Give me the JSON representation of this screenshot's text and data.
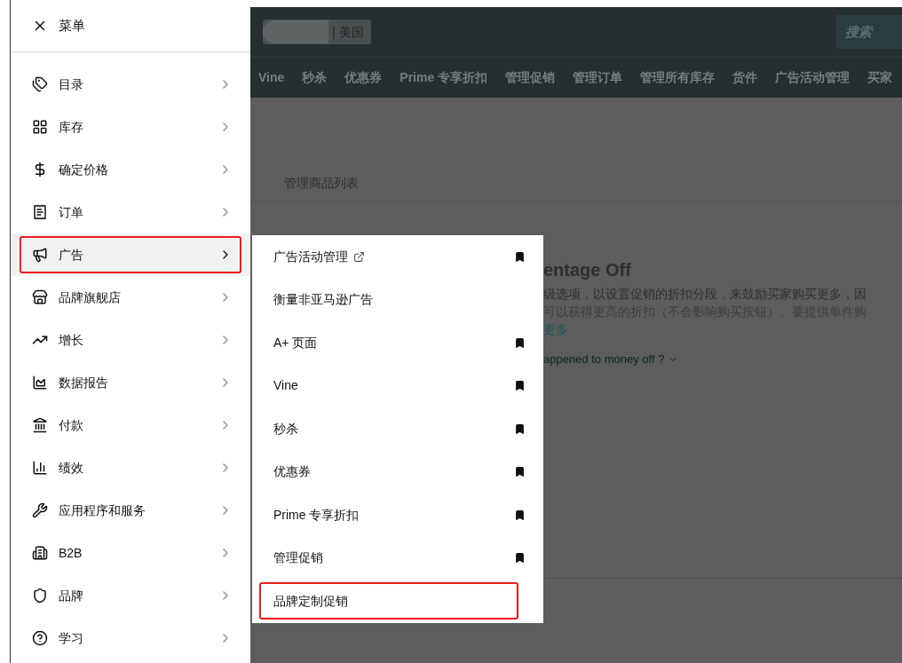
{
  "menu": {
    "title": "菜单",
    "items": [
      {
        "label": "目录",
        "selected": false,
        "outlined": false
      },
      {
        "label": "库存",
        "selected": false,
        "outlined": false
      },
      {
        "label": "确定价格",
        "selected": false,
        "outlined": false
      },
      {
        "label": "订单",
        "selected": false,
        "outlined": false
      },
      {
        "label": "广告",
        "selected": true,
        "outlined": true
      },
      {
        "label": "品牌旗舰店",
        "selected": false,
        "outlined": false
      },
      {
        "label": "增长",
        "selected": false,
        "outlined": false
      },
      {
        "label": "数据报告",
        "selected": false,
        "outlined": false
      },
      {
        "label": "付款",
        "selected": false,
        "outlined": false
      },
      {
        "label": "绩效",
        "selected": false,
        "outlined": false
      },
      {
        "label": "应用程序和服务",
        "selected": false,
        "outlined": false
      },
      {
        "label": "B2B",
        "selected": false,
        "outlined": false
      },
      {
        "label": "品牌",
        "selected": false,
        "outlined": false
      },
      {
        "label": "学习",
        "selected": false,
        "outlined": false
      }
    ]
  },
  "submenu": {
    "items": [
      {
        "label": "广告活动管理",
        "external": true,
        "bookmarked": true,
        "outlined": false
      },
      {
        "label": "衡量非亚马逊广告",
        "external": false,
        "bookmarked": false,
        "outlined": false
      },
      {
        "label": "A+ 页面",
        "external": false,
        "bookmarked": true,
        "outlined": false
      },
      {
        "label": "Vine",
        "external": false,
        "bookmarked": true,
        "outlined": false
      },
      {
        "label": "秒杀",
        "external": false,
        "bookmarked": true,
        "outlined": false
      },
      {
        "label": "优惠券",
        "external": false,
        "bookmarked": true,
        "outlined": false
      },
      {
        "label": "Prime 专享折扣",
        "external": false,
        "bookmarked": true,
        "outlined": false
      },
      {
        "label": "管理促销",
        "external": false,
        "bookmarked": true,
        "outlined": false
      },
      {
        "label": "品牌定制促销",
        "external": false,
        "bookmarked": false,
        "outlined": true
      }
    ]
  },
  "header": {
    "marketplace": "| 美国",
    "search": "搜索"
  },
  "nav": [
    "Vine",
    "秒杀",
    "优惠券",
    "Prime 专享折扣",
    "管理促销",
    "管理订单",
    "管理所有库存",
    "货件",
    "广告活动管理",
    "买家"
  ],
  "page": {
    "tab": "管理商品列表",
    "heading": "entage Off",
    "description": [
      "级选项，以设置促销的折扣分段，来鼓励买家购买更多，因",
      "可以获得更高的折扣（不会影响购买按钮）。要提供单件购"
    ],
    "link": "更多",
    "question": "appened to money off ?"
  }
}
